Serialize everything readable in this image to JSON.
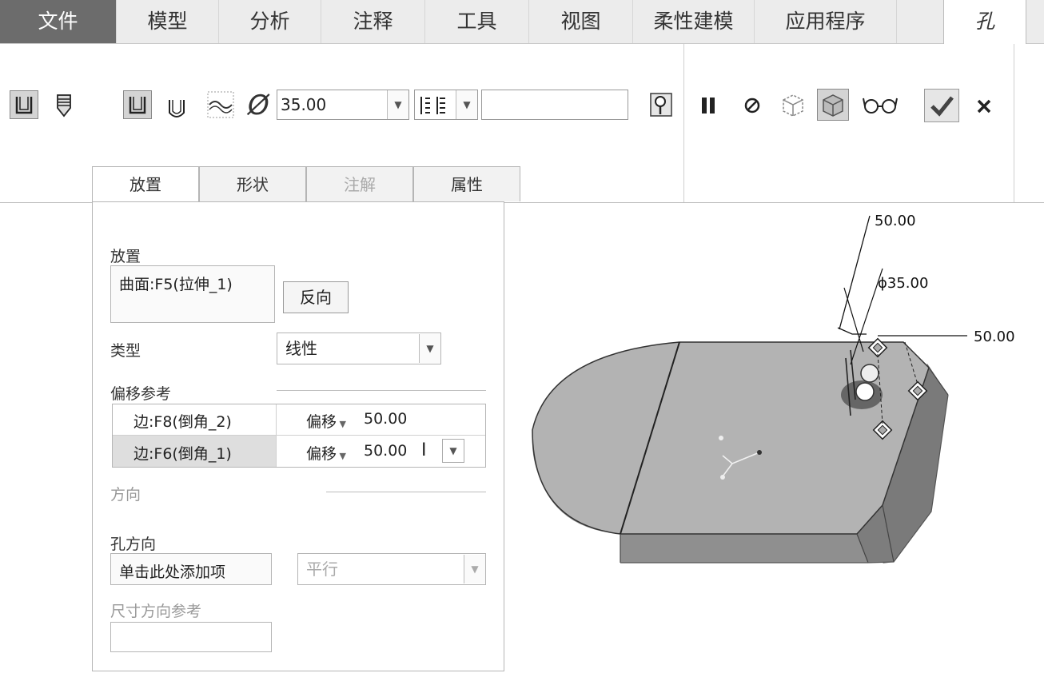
{
  "menubar": {
    "items": [
      "文件",
      "模型",
      "分析",
      "注释",
      "工具",
      "视图",
      "柔性建模",
      "应用程序",
      "孔"
    ]
  },
  "ribbon": {
    "diameter_symbol": "Ø",
    "diameter_value": "35.00",
    "depth_value": ""
  },
  "dashboard_tabs": [
    "放置",
    "形状",
    "注解",
    "属性"
  ],
  "placement_panel": {
    "placement_label": "放置",
    "placement_ref": "曲面:F5(拉伸_1)",
    "flip_button": "反向",
    "type_label": "类型",
    "type_value": "线性",
    "offset_refs_label": "偏移参考",
    "offset_rows": [
      {
        "ref": "边:F8(倒角_2)",
        "mode": "偏移",
        "value": "50.00"
      },
      {
        "ref": "边:F6(倒角_1)",
        "mode": "偏移",
        "value": "50.00"
      }
    ],
    "direction_label": "方向",
    "hole_direction_label": "孔方向",
    "hole_direction_add": "单击此处添加项",
    "hole_direction_mode": "平行",
    "dim_direction_ref_label": "尺寸方向参考"
  },
  "model_annotations": {
    "dim_offset_top": "50.00",
    "dim_diameter": "ϕ35.00",
    "dim_offset_right": "50.00"
  },
  "colors": {
    "file_menu": "#6c6c6c",
    "model_top": "#b3b3b3",
    "model_side": "#8a8a8a",
    "model_edge": "#333333"
  }
}
